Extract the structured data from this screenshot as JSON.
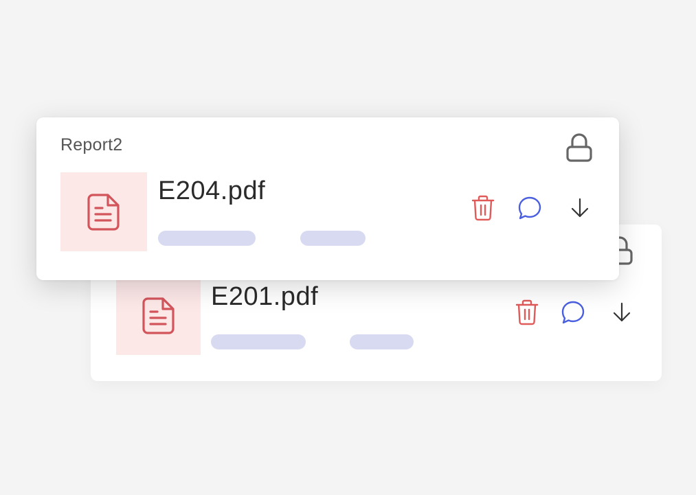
{
  "colors": {
    "background": "#f4f4f4",
    "card": "#ffffff",
    "thumb_bg": "#fde8e8",
    "file_icon": "#d3555c",
    "trash": "#e05a5a",
    "comment": "#4a5fe0",
    "download": "#333333",
    "lock": "#666666",
    "placeholder_bar": "#d8daf2"
  },
  "cards": [
    {
      "report_label": "Report2",
      "file_name": "E204.pdf",
      "icons": {
        "thumbnail": "document-icon",
        "lock": "lock-icon",
        "delete": "trash-icon",
        "comment": "comment-icon",
        "download": "download-icon"
      }
    },
    {
      "file_name": "E201.pdf",
      "icons": {
        "thumbnail": "document-icon",
        "lock": "lock-icon",
        "delete": "trash-icon",
        "comment": "comment-icon",
        "download": "download-icon"
      }
    }
  ]
}
